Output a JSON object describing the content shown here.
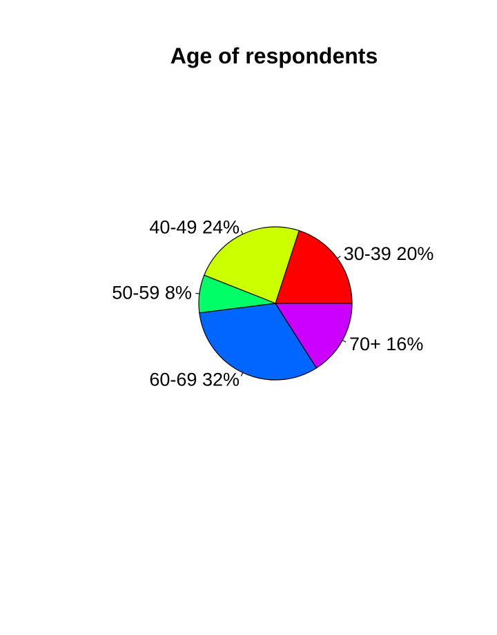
{
  "chart_data": {
    "type": "pie",
    "title": "Age of respondents",
    "slices": [
      {
        "label": "30-39 20%",
        "category": "30-39",
        "value": 20,
        "color": "#FF0000"
      },
      {
        "label": "40-49 24%",
        "category": "40-49",
        "value": 24,
        "color": "#CCFF00"
      },
      {
        "label": "50-59 8%",
        "category": "50-59",
        "value": 8,
        "color": "#00FF66"
      },
      {
        "label": "60-69 32%",
        "category": "60-69",
        "value": 32,
        "color": "#0066FF"
      },
      {
        "label": "70+ 16%",
        "category": "70+",
        "value": 16,
        "color": "#CC00FF"
      }
    ],
    "direction": "counterclockwise",
    "start": "3 o'clock"
  }
}
